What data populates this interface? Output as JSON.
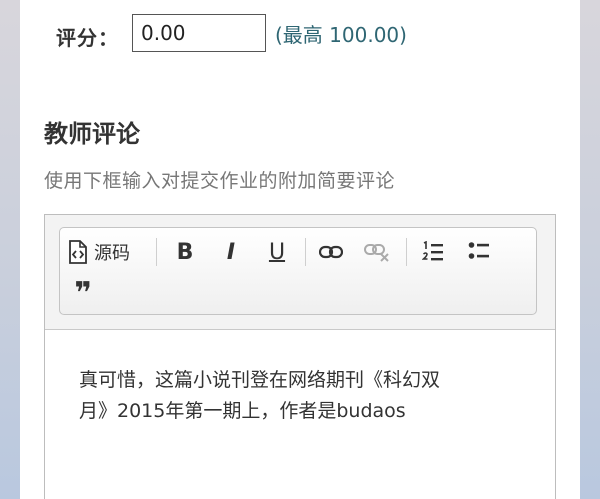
{
  "grade": {
    "label": "评分：",
    "value": "0.00",
    "max_text": "(最高 100.00)"
  },
  "feedback": {
    "title": "教师评论",
    "description": "使用下框输入对提交作业的附加简要评论"
  },
  "editor": {
    "toolbar": {
      "source_label": "源码",
      "bold_glyph": "B",
      "italic_glyph": "I",
      "underline_glyph": "U",
      "blockquote_glyph": "❞"
    },
    "content_lines": [
      "真可惜，这篇小说刊登在网络期刊《科幻双",
      "月》2015年第一期上，作者是budaos"
    ]
  },
  "colors": {
    "accent": "#2f6673",
    "text": "#333333",
    "muted": "#777777"
  }
}
